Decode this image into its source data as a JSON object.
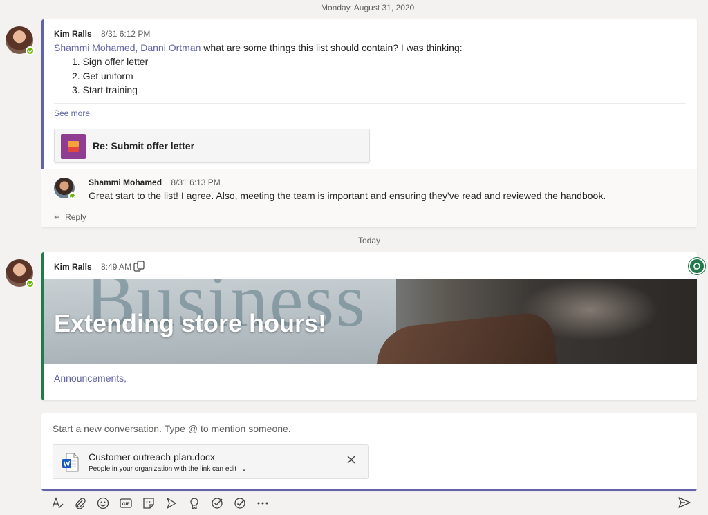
{
  "dates": {
    "first": "Monday, August 31, 2020",
    "second": "Today"
  },
  "thread1": {
    "author": "Kim Ralls",
    "time": "8/31 6:12 PM",
    "mentions": "Shammi Mohamed, Danni Ortman",
    "text": " what are some things this list should contain? I was thinking:",
    "list": [
      "1. Sign offer letter",
      "2. Get uniform",
      "3. Start training"
    ],
    "see_more": "See more",
    "loop_title": "Re: Submit offer letter",
    "reply": {
      "author": "Shammi Mohamed",
      "time": "8/31 6:13 PM",
      "text": "Great start to the list! I agree. Also, meeting the team is important and ensuring they've read and reviewed the handbook."
    },
    "reply_label": "Reply"
  },
  "thread2": {
    "author": "Kim Ralls",
    "time": "8:49 AM",
    "banner_title": "Extending store hours!",
    "banner_paper_word": "Business",
    "tag": "Announcements,"
  },
  "compose": {
    "placeholder": "Start a new conversation. Type @ to mention someone.",
    "attachment": {
      "name": "Customer outreach plan.docx",
      "permission": "People in your organization with the link can edit"
    }
  },
  "toolbar": [
    "format-icon",
    "attach-icon",
    "emoji-icon",
    "gif-icon",
    "sticker-icon",
    "meet-icon",
    "praise-icon",
    "approvals-icon",
    "tasks-icon",
    "more-icon"
  ],
  "colors": {
    "accent": "#6264a7",
    "green": "#237b4b",
    "presence": "#6bb700"
  }
}
